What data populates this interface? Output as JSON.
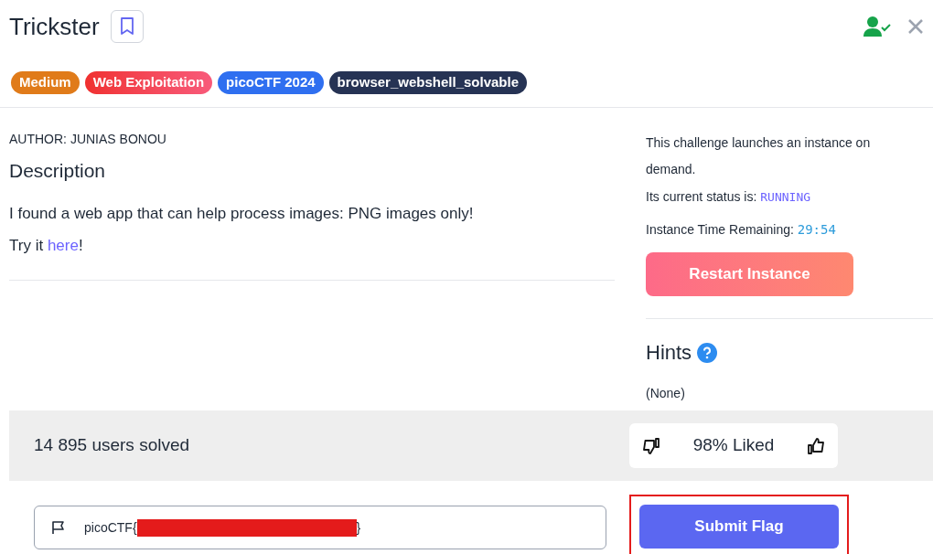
{
  "header": {
    "title": "Trickster",
    "bookmarked": false
  },
  "tags": [
    {
      "label": "Medium",
      "kind": "difficulty"
    },
    {
      "label": "Web Exploitation",
      "kind": "category"
    },
    {
      "label": "picoCTF 2024",
      "kind": "event"
    },
    {
      "label": "browser_webshell_solvable",
      "kind": "feature"
    }
  ],
  "description": {
    "author": "AUTHOR: JUNIAS BONOU",
    "heading": "Description",
    "text": "I found a web app that can help process images: PNG images only!",
    "try_prefix": "Try it ",
    "link": "here",
    "try_suffix": "!"
  },
  "instance": {
    "intro": "This challenge launches an instance on demand.",
    "status_label": "Its current status is: ",
    "status": "RUNNING",
    "time_label": "Instance Time Remaining: ",
    "time": "29:54",
    "button": "Restart Instance"
  },
  "hints": {
    "heading": "Hints",
    "text": "(None)"
  },
  "stats": {
    "solved": "14 895 users solved",
    "liked": "98% Liked"
  },
  "flag": {
    "prefix": "picoCTF{",
    "suffix": "}",
    "redacted": true,
    "button": "Submit Flag",
    "highlighted": true
  }
}
